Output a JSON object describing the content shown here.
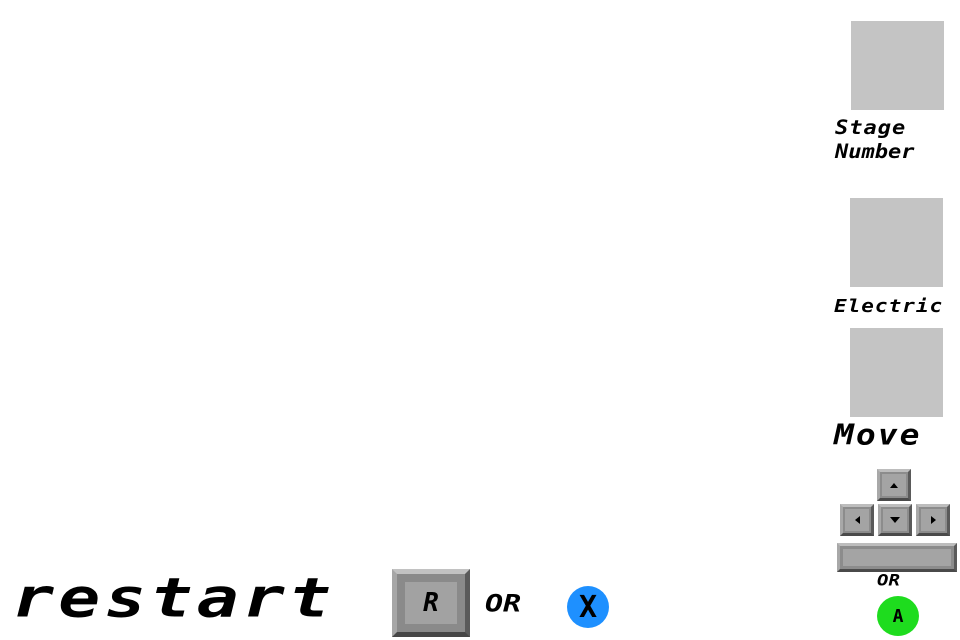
{
  "hud": {
    "stage_label_line1": "Stage",
    "stage_label_line2": "Number",
    "electric_label": "Electric",
    "move_label": "Move",
    "or_label": "OR",
    "gamepad_a_label": "A"
  },
  "controls": {
    "move_keys": [
      "arrow-up-icon",
      "arrow-left-icon",
      "arrow-down-icon",
      "arrow-right-icon"
    ],
    "action_key": "space-bar-icon"
  },
  "restart": {
    "label": "restart",
    "key_label": "R",
    "or_label": "OR",
    "gamepad_x_label": "X"
  },
  "colors": {
    "background": "#ffffff",
    "slot": "#c4c4c4",
    "key_face": "#a4a4a4",
    "gamepad_a": "#1edc1e",
    "gamepad_x": "#1e90ff"
  }
}
